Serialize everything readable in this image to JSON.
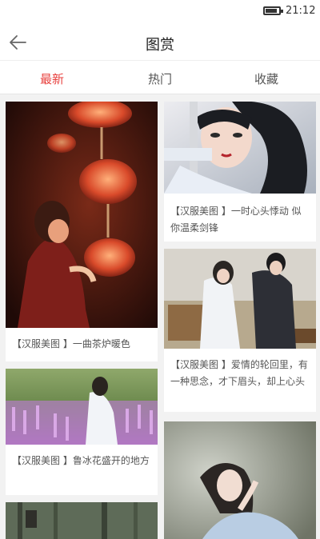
{
  "status": {
    "time": "21:12"
  },
  "header": {
    "title": "图赏"
  },
  "tabs": [
    {
      "label": "最新",
      "active": true
    },
    {
      "label": "热门",
      "active": false
    },
    {
      "label": "收藏",
      "active": false
    }
  ],
  "cards": [
    {
      "caption": "【汉服美图 】一曲茶炉暖色"
    },
    {
      "caption": "【汉服美图 】一时心头悸动 似你温柔剑锋"
    },
    {
      "caption": "【汉服美图 】鲁冰花盛开的地方"
    },
    {
      "caption": "【汉服美图 】爱情的轮回里，有一种思念，才下眉头，却上心头"
    },
    {
      "caption": ""
    },
    {
      "caption": ""
    }
  ],
  "colors": {
    "accent": "#e8423f",
    "text": "#555555",
    "background": "#f2f2f2"
  }
}
